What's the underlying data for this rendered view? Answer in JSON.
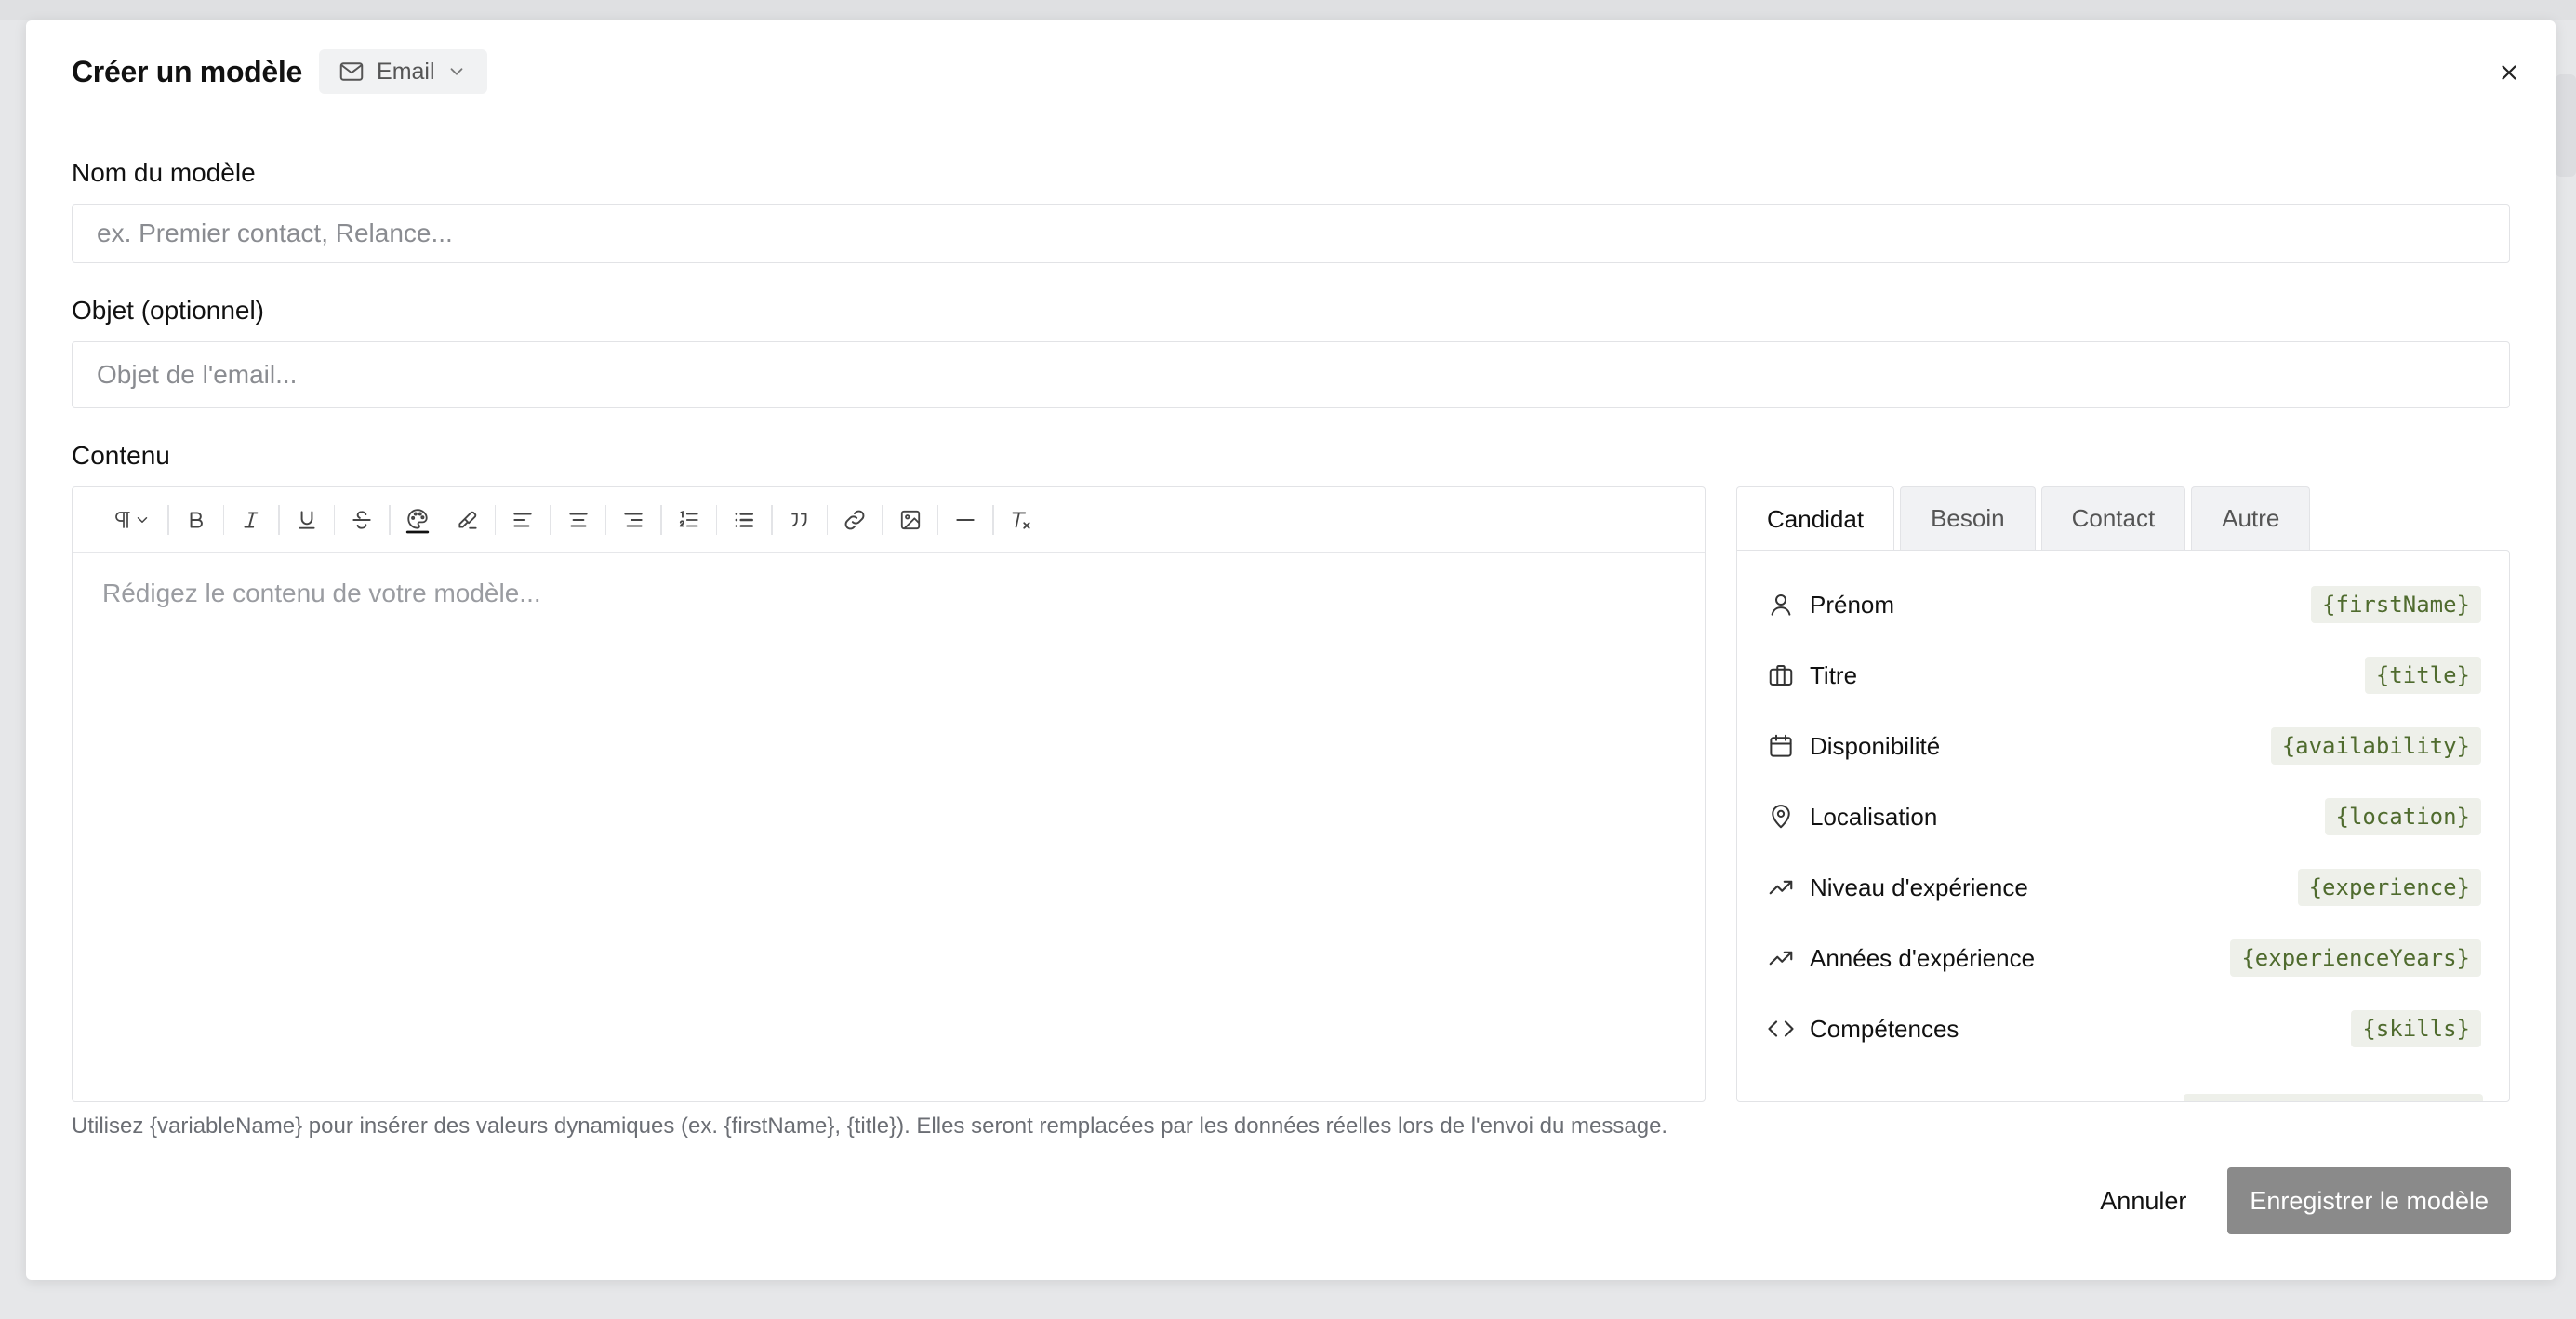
{
  "modal": {
    "title": "Créer un modèle",
    "channel": {
      "label": "Email",
      "icon": "mail-icon"
    },
    "close_icon": "close-icon"
  },
  "fields": {
    "name": {
      "label": "Nom du modèle",
      "placeholder": "ex. Premier contact, Relance..."
    },
    "subject": {
      "label": "Objet (optionnel)",
      "placeholder": "Objet de l'email..."
    },
    "content": {
      "label": "Contenu",
      "placeholder": "Rédigez le contenu de votre modèle..."
    }
  },
  "toolbar": {
    "buttons": [
      "paragraph-style-icon",
      "bold-icon",
      "italic-icon",
      "underline-icon",
      "strikethrough-icon",
      "text-color-icon",
      "highlight-icon",
      "align-left-icon",
      "align-center-icon",
      "align-right-icon",
      "ordered-list-icon",
      "bullet-list-icon",
      "blockquote-icon",
      "link-icon",
      "image-icon",
      "horizontal-rule-icon",
      "clear-format-icon"
    ]
  },
  "helper_text": "Utilisez {variableName} pour insérer des valeurs dynamiques (ex. {firstName}, {title}). Elles seront remplacées par les données réelles lors de l'envoi du message.",
  "variables": {
    "tabs": [
      {
        "label": "Candidat",
        "active": true
      },
      {
        "label": "Besoin",
        "active": false
      },
      {
        "label": "Contact",
        "active": false
      },
      {
        "label": "Autre",
        "active": false
      }
    ],
    "items": [
      {
        "icon": "user-icon",
        "label": "Prénom",
        "code": "{firstName}"
      },
      {
        "icon": "briefcase-icon",
        "label": "Titre",
        "code": "{title}"
      },
      {
        "icon": "calendar-icon",
        "label": "Disponibilité",
        "code": "{availability}"
      },
      {
        "icon": "map-pin-icon",
        "label": "Localisation",
        "code": "{location}"
      },
      {
        "icon": "trending-up-icon",
        "label": "Niveau d'expérience",
        "code": "{experience}"
      },
      {
        "icon": "trending-up-icon",
        "label": "Années d'expérience",
        "code": "{experienceYears}"
      },
      {
        "icon": "code-icon",
        "label": "Compétences",
        "code": "{skills}"
      }
    ]
  },
  "footer": {
    "cancel_label": "Annuler",
    "save_label": "Enregistrer le modèle"
  },
  "colors": {
    "save_button_bg": "#8a8a8a",
    "code_text": "#4f6b2e",
    "code_bg": "#eef0ea"
  }
}
